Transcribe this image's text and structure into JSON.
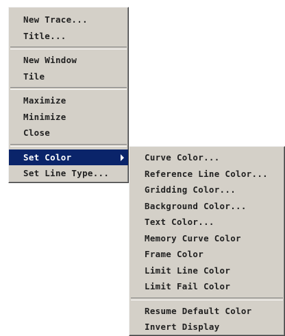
{
  "main_menu": {
    "items": [
      {
        "label": "New Trace..."
      },
      {
        "label": "Title..."
      },
      {
        "label": "New Window"
      },
      {
        "label": "Tile"
      },
      {
        "label": "Maximize"
      },
      {
        "label": "Minimize"
      },
      {
        "label": "Close"
      },
      {
        "label": "Set Color"
      },
      {
        "label": "Set Line Type..."
      }
    ]
  },
  "set_color_submenu": {
    "items": [
      {
        "label": "Curve Color..."
      },
      {
        "label": "Reference Line Color..."
      },
      {
        "label": "Gridding Color..."
      },
      {
        "label": "Background Color..."
      },
      {
        "label": "Text Color..."
      },
      {
        "label": "Memory Curve Color"
      },
      {
        "label": "Frame Color"
      },
      {
        "label": "Limit Line Color"
      },
      {
        "label": "Limit Fail Color"
      },
      {
        "label": "Resume Default Color"
      },
      {
        "label": "Invert Display"
      }
    ]
  },
  "colors": {
    "menu_background": "#d4d0c8",
    "highlight_background": "#0a246a",
    "highlight_text": "#ffffff",
    "text": "#202020"
  },
  "icons": {
    "submenu_arrow": "submenu-arrow-icon"
  }
}
